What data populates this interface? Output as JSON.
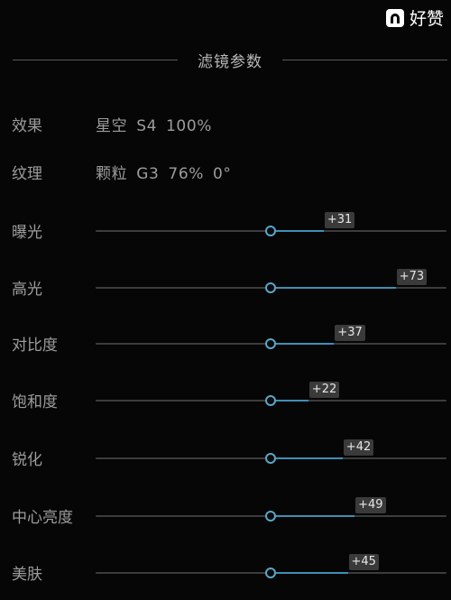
{
  "watermark": {
    "text": "好赞",
    "icon": "haozan-logo-icon"
  },
  "section": {
    "title": "滤镜参数"
  },
  "info": [
    {
      "label": "效果",
      "value": "星空  S4  100%"
    },
    {
      "label": "纹理",
      "value": "颗粒  G3  76%  0°"
    }
  ],
  "sliders": [
    {
      "name": "exposure",
      "label": "曝光",
      "value": 31,
      "display": "+31"
    },
    {
      "name": "highlights",
      "label": "高光",
      "value": 73,
      "display": "+73"
    },
    {
      "name": "contrast",
      "label": "对比度",
      "value": 37,
      "display": "+37"
    },
    {
      "name": "saturation",
      "label": "饱和度",
      "value": 22,
      "display": "+22"
    },
    {
      "name": "sharpen",
      "label": "锐化",
      "value": 42,
      "display": "+42"
    },
    {
      "name": "center-brightness",
      "label": "中心亮度",
      "value": 49,
      "display": "+49"
    },
    {
      "name": "skin-beautify",
      "label": "美肤",
      "value": 45,
      "display": "+45"
    }
  ],
  "colors": {
    "background": "#060606",
    "track": "#3c3c3c",
    "accent": "#3f8fb5",
    "badge": "#3a3a3a"
  }
}
